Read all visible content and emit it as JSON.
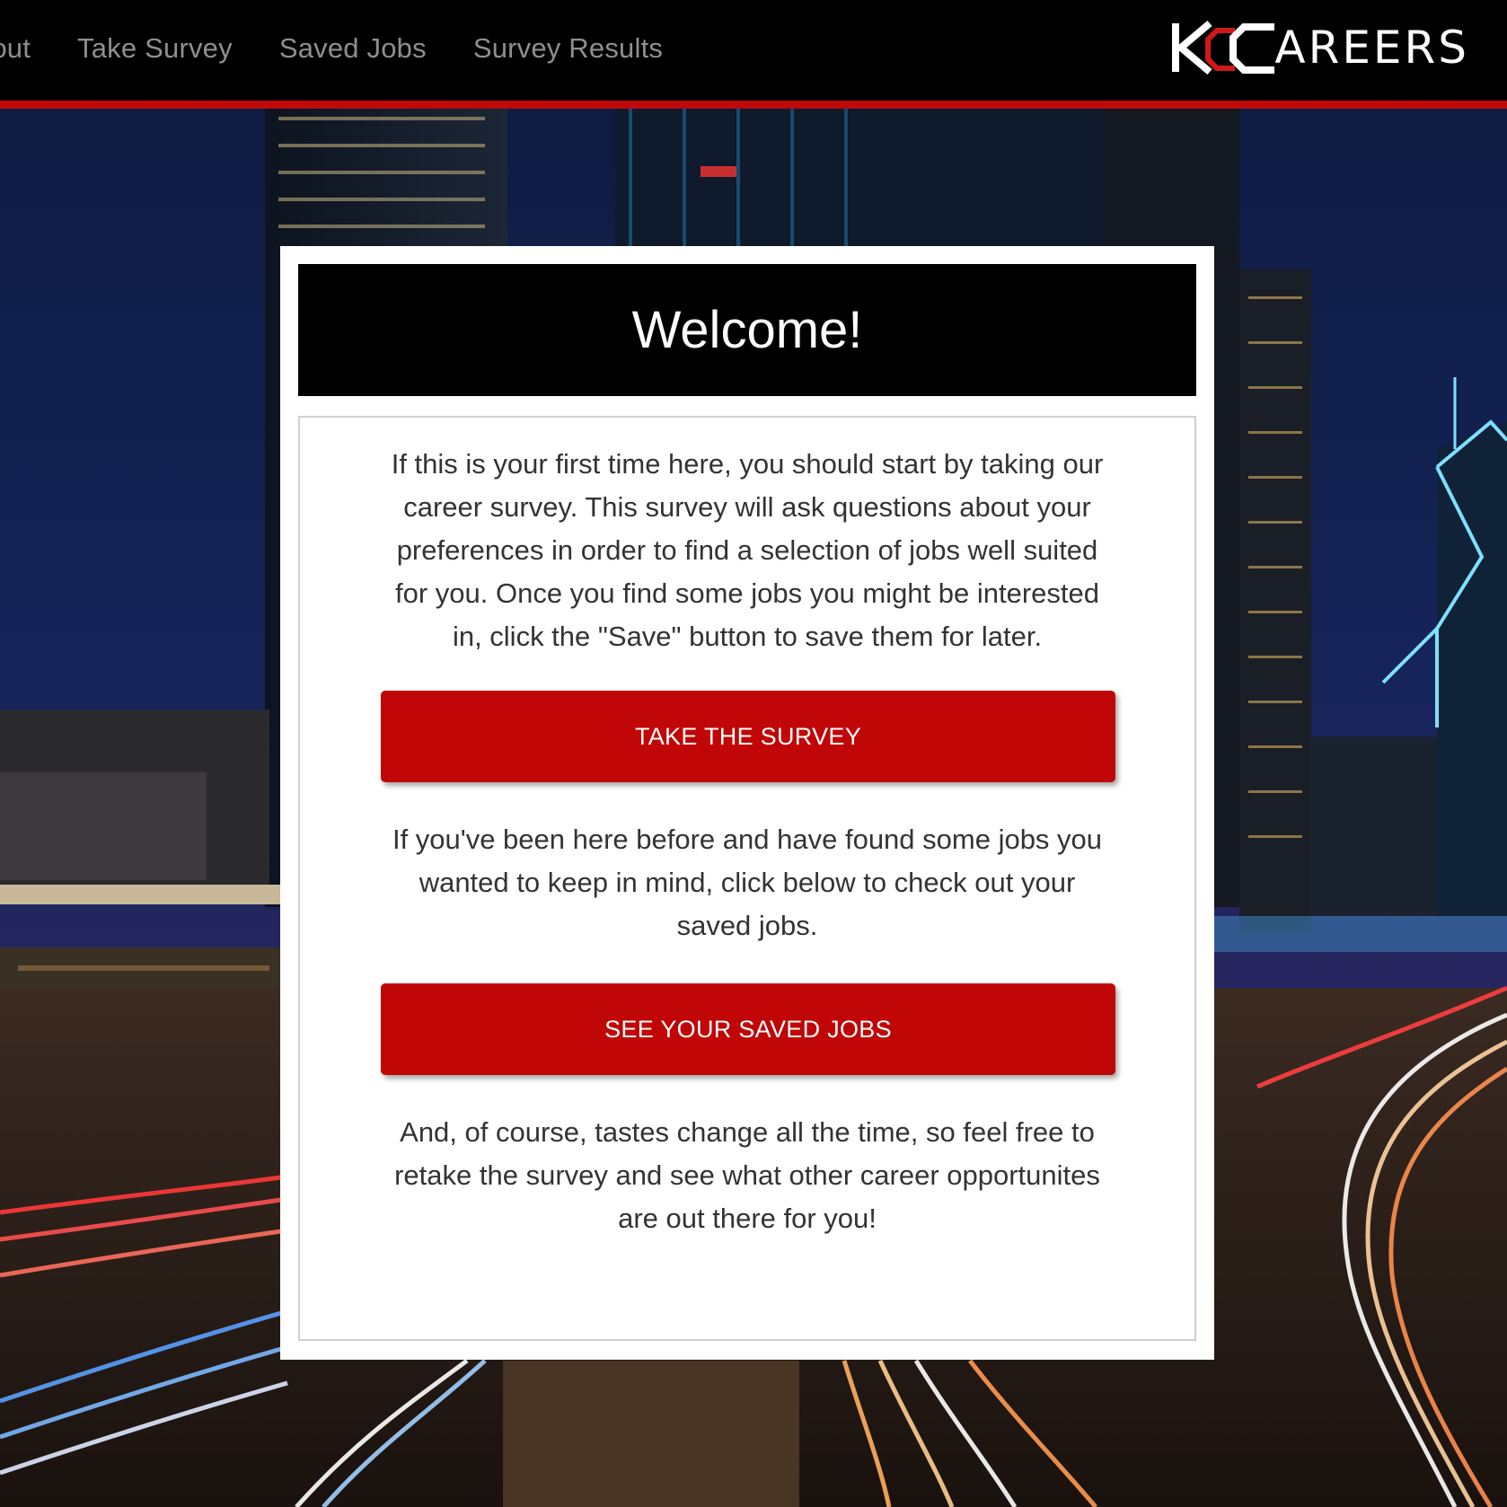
{
  "nav": {
    "items": [
      {
        "label": "Logout"
      },
      {
        "label": "Take Survey"
      },
      {
        "label": "Saved Jobs"
      },
      {
        "label": "Survey Results"
      }
    ]
  },
  "logo": {
    "mark_letters": "KC",
    "text": "AREERS",
    "full_alt": "KCCAREERS"
  },
  "welcome": {
    "title": "Welcome!",
    "intro_text": "If this is your first time here, you should start by taking our career survey. This survey will ask questions about your preferences in order to find a selection of jobs well suited for you. Once you find some jobs you might be interested in, click the \"Save\" button to save them for later.",
    "take_survey_button": "TAKE THE SURVEY",
    "returning_text": "If you've been here before and have found some jobs you wanted to keep in mind, click below to check out your saved jobs.",
    "saved_jobs_button": "SEE YOUR SAVED JOBS",
    "closing_text": "And, of course, tastes change all the time, so feel free to retake the survey and see what other career opportunites are out there for you!"
  },
  "colors": {
    "accent_red": "#c00606",
    "nav_text": "#8f8f8f",
    "header_bg": "#000000"
  }
}
